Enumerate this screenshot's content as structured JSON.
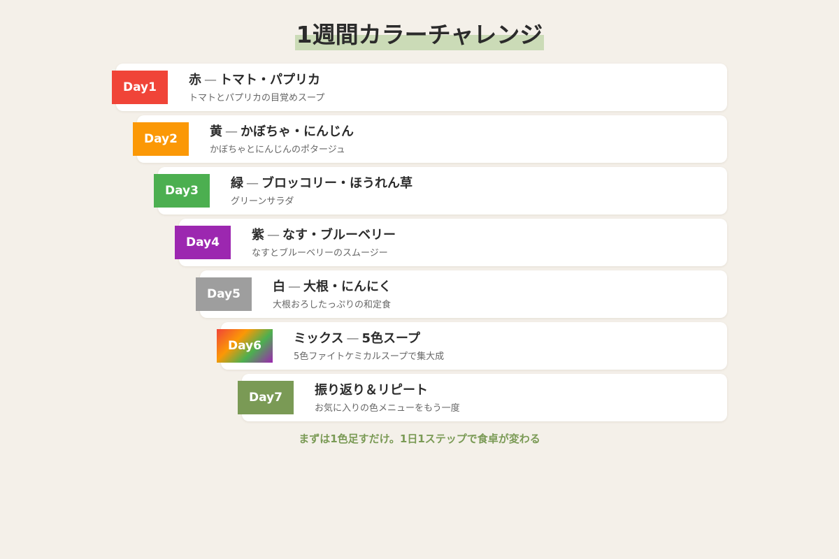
{
  "title": "1週間カラーチャレンジ",
  "separator": "—",
  "days": [
    {
      "label": "Day1",
      "color": "#f04438",
      "name": "赤",
      "items": "トマト・パプリカ",
      "desc": "トマトとパプリカの目覚めスープ"
    },
    {
      "label": "Day2",
      "color": "#fb9806",
      "name": "黄",
      "items": "かぼちゃ・にんじん",
      "desc": "かぼちゃとにんじんのポタージュ"
    },
    {
      "label": "Day3",
      "color": "#4caf50",
      "name": "緑",
      "items": "ブロッコリー・ほうれん草",
      "desc": "グリーンサラダ"
    },
    {
      "label": "Day4",
      "color": "#9c27b0",
      "name": "紫",
      "items": "なす・ブルーベリー",
      "desc": "なすとブルーベリーのスムージー"
    },
    {
      "label": "Day5",
      "color": "#9e9e9e",
      "name": "白",
      "items": "大根・にんにく",
      "desc": "大根おろしたっぷりの和定食"
    },
    {
      "label": "Day6",
      "color": "mix",
      "name": "ミックス",
      "items": "5色スープ",
      "desc": "5色ファイトケミカルスープで集大成"
    },
    {
      "label": "Day7",
      "color": "#7a9a55",
      "name": "振り返り＆リピート",
      "items": "",
      "desc": "お気に入りの色メニューをもう一度"
    }
  ],
  "footer": "まずは1色足すだけ。1日1ステップで食卓が変わる"
}
